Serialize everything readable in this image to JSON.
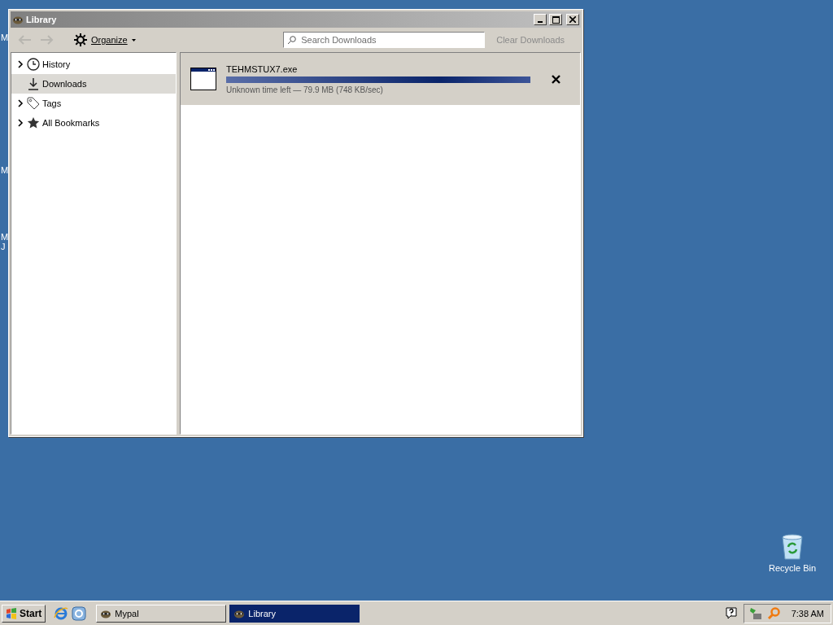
{
  "desktop": {
    "edge_labels": [
      {
        "text": "M"
      },
      {
        "text": "M"
      },
      {
        "text": "M"
      },
      {
        "text": "J"
      }
    ],
    "icons": [
      {
        "label": "Recycle Bin"
      }
    ]
  },
  "window": {
    "title": "Library",
    "active": false,
    "toolbar": {
      "organize": "Organize",
      "search": {
        "placeholder": "Search Downloads"
      },
      "clear": "Clear Downloads"
    },
    "sidebar": {
      "items": [
        {
          "label": "History",
          "kind": "history",
          "expandable": true,
          "selected": false
        },
        {
          "label": "Downloads",
          "kind": "downloads",
          "expandable": false,
          "selected": true
        },
        {
          "label": "Tags",
          "kind": "tags",
          "expandable": true,
          "selected": false
        },
        {
          "label": "All Bookmarks",
          "kind": "bookmarks",
          "expandable": true,
          "selected": false
        }
      ]
    },
    "downloads": [
      {
        "name": "TEHMSTUX7.exe",
        "level": 1,
        "status": "Unknown time left — 79.9 MB (748 KB/sec)"
      }
    ]
  },
  "taskbar": {
    "start": "Start",
    "tasks": [
      {
        "label": "Mypal",
        "selected": false
      },
      {
        "label": "Library",
        "selected": true
      }
    ],
    "clock": "7:38 AM"
  }
}
